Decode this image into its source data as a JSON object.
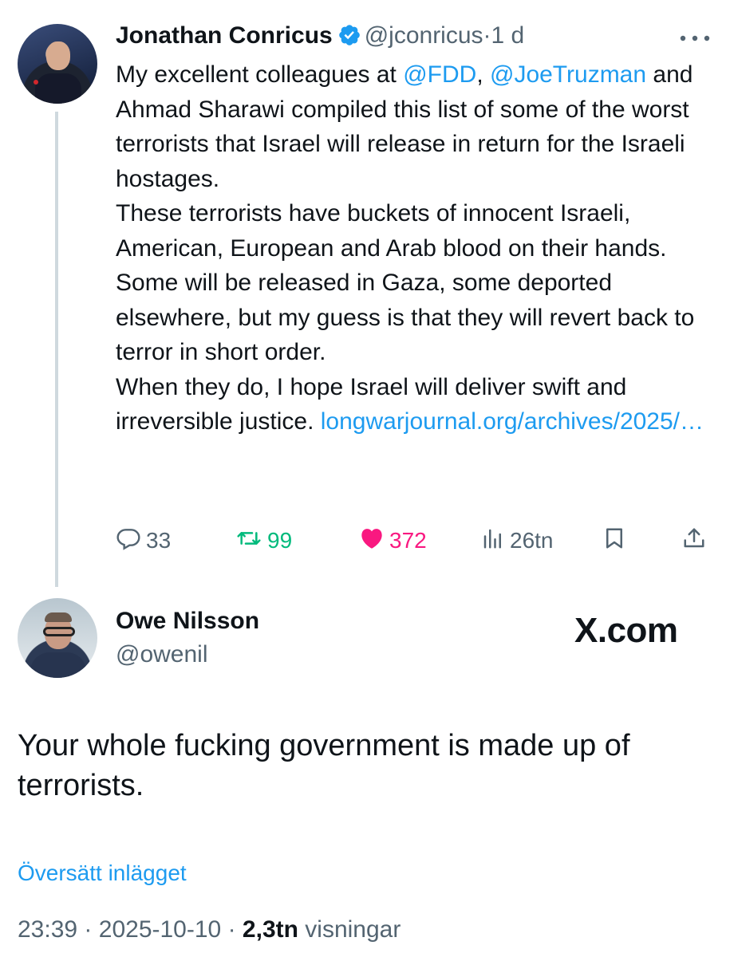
{
  "parent_tweet": {
    "author_name": "Jonathan Conricus",
    "handle": "@jconricus",
    "separator": "·",
    "time": "1 d",
    "paragraphs": [
      [
        {
          "t": "My excellent colleagues at ",
          "link": false
        },
        {
          "t": "@FDD",
          "link": true
        },
        {
          "t": ", ",
          "link": false
        },
        {
          "t": "@JoeTruzman",
          "link": true
        },
        {
          "t": " and Ahmad Sharawi compiled this list of some of the worst terrorists that Israel will release in return for the Israeli hostages.",
          "link": false
        }
      ],
      [
        {
          "t": "These terrorists have buckets of innocent Israeli, American, European and Arab blood on their hands. Some will be released in Gaza, some deported elsewhere, but my guess is that they will revert back to terror in short order.",
          "link": false
        }
      ],
      [
        {
          "t": "When they do, I hope Israel will deliver swift and irreversible justice. ",
          "link": false
        },
        {
          "t": "longwarjournal.org/archives/2025/…",
          "link": true
        }
      ]
    ],
    "actions": {
      "replies": "33",
      "reposts": "99",
      "likes": "372",
      "views": "26tn"
    },
    "colors": {
      "repost": "#00ba7c",
      "like": "#f91880",
      "link": "#1d9bf0",
      "muted": "#536471"
    }
  },
  "reply_tweet": {
    "author_name": "Owe Nilsson",
    "handle": "@owenil",
    "watermark": "X.com",
    "text": "Your whole fucking government is made up of terrorists.",
    "translate_label": "Översätt inlägget",
    "time": "23:39",
    "date": "2025-10-10",
    "views_count": "2,3tn",
    "views_label": "visningar",
    "separator": "·"
  }
}
